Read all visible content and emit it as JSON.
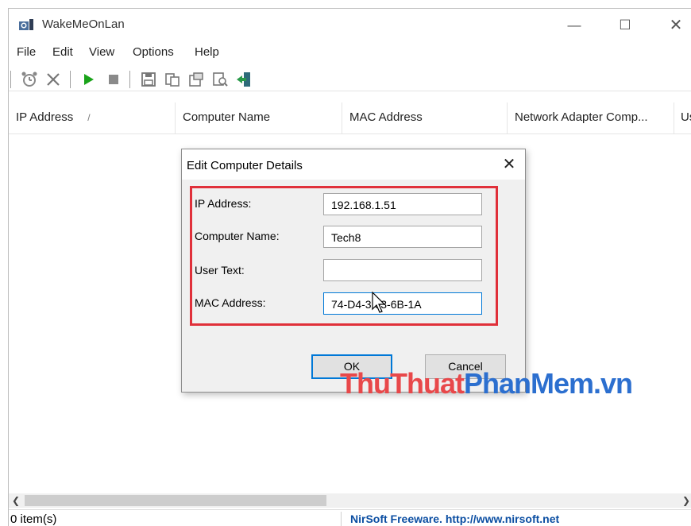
{
  "window": {
    "title": "WakeMeOnLan",
    "controls": {
      "minimize": "—",
      "maximize": "☐",
      "close": "✕"
    }
  },
  "menu": [
    "File",
    "Edit",
    "View",
    "Options",
    "Help"
  ],
  "toolbar": {
    "buttons": [
      "alarm-clock-icon",
      "delete-icon",
      "play-icon",
      "stop-icon",
      "save-icon",
      "copy-icon",
      "properties-icon",
      "find-icon",
      "exit-icon"
    ]
  },
  "columns": [
    {
      "label": "IP Address",
      "sort": "/"
    },
    {
      "label": "Computer Name"
    },
    {
      "label": "MAC Address"
    },
    {
      "label": "Network Adapter Comp..."
    },
    {
      "label": "Us"
    }
  ],
  "status": {
    "count": "0 item(s)",
    "link": "NirSoft Freeware.  http://www.nirsoft.net"
  },
  "dialog": {
    "title": "Edit Computer Details",
    "close": "✕",
    "fields": {
      "ip": {
        "label": "IP Address:",
        "value": "192.168.1.51"
      },
      "name": {
        "label": "Computer Name:",
        "value": "Tech8"
      },
      "user_text": {
        "label": "User Text:",
        "value": ""
      },
      "mac": {
        "label": "MAC Address:",
        "value": "74-D4-3 03-6B-1A"
      }
    },
    "ok": "OK",
    "cancel": "Cancel",
    "highlight_color": "#e0303a"
  },
  "watermark": {
    "part1": "ThuThuat",
    "part2": "PhanMem",
    "part3": ".vn"
  },
  "colors": {
    "link": "#0b4ea2",
    "focus": "#0078d7",
    "play": "#1aa31a"
  }
}
